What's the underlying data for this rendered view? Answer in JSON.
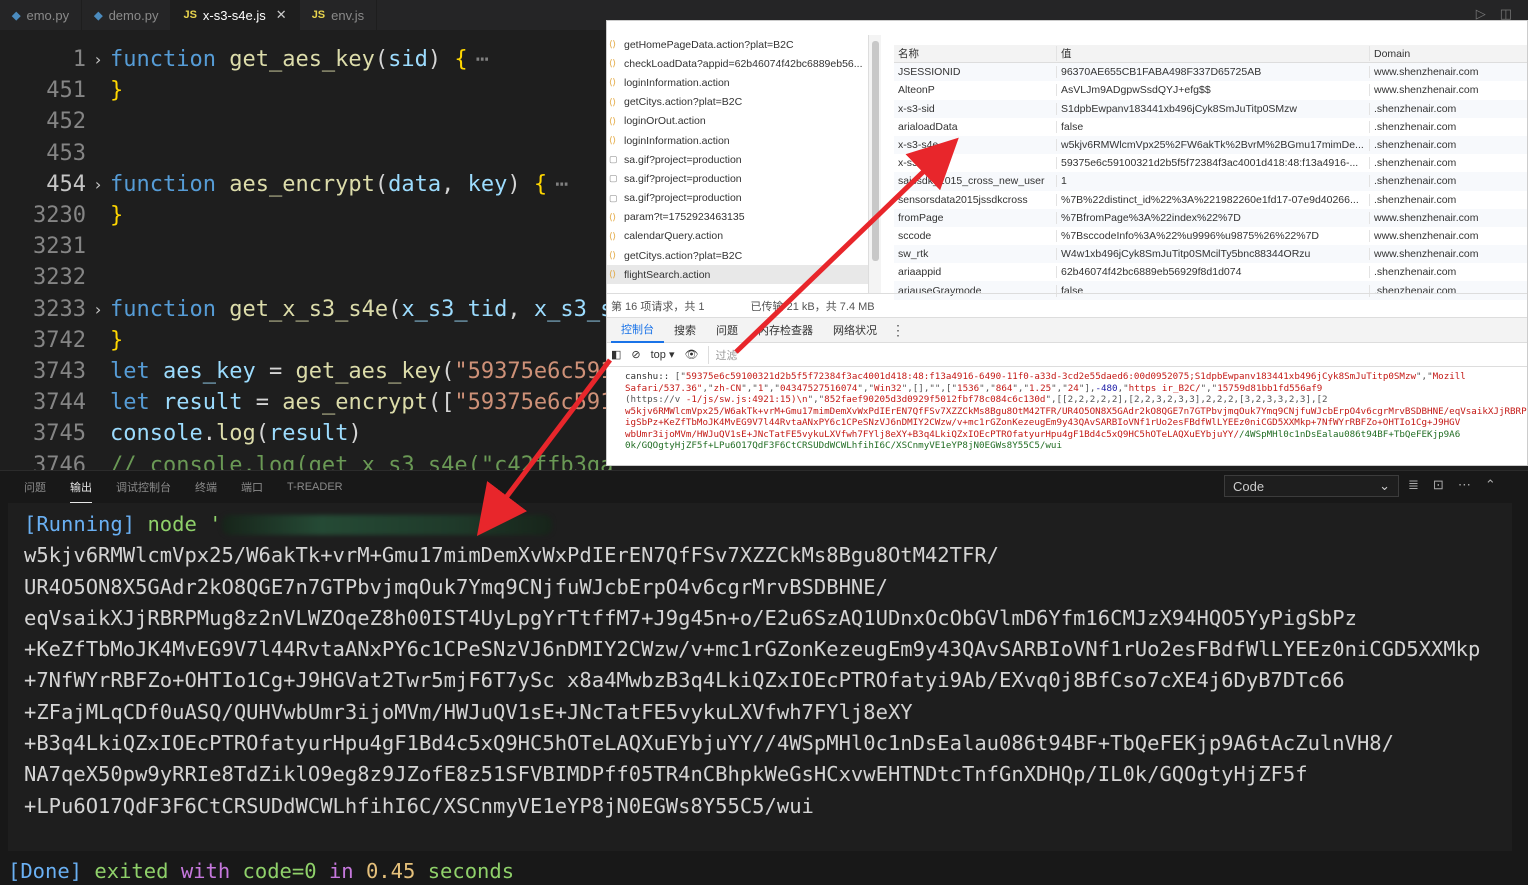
{
  "tabs": [
    {
      "name": "emo.py",
      "type": "py",
      "active": false
    },
    {
      "name": "demo.py",
      "type": "py",
      "active": false
    },
    {
      "name": "x-s3-s4e.js",
      "type": "js",
      "active": true
    },
    {
      "name": "env.js",
      "type": "js",
      "active": false
    }
  ],
  "tab_icons": {
    "py": "python-icon",
    "js": "JS"
  },
  "editor": {
    "lines": [
      {
        "num": "1",
        "fold": true,
        "parts": [
          [
            "kw",
            "function "
          ],
          [
            "fn",
            "get_aes_key"
          ],
          [
            "op",
            "("
          ],
          [
            "par",
            "sid"
          ],
          [
            "op",
            ") "
          ],
          [
            "br",
            "{"
          ]
        ],
        "dots": true
      },
      {
        "num": "451",
        "parts": [
          [
            "br",
            "}"
          ]
        ]
      },
      {
        "num": "452",
        "parts": []
      },
      {
        "num": "453",
        "parts": []
      },
      {
        "num": "454",
        "fold": true,
        "cur": true,
        "parts": [
          [
            "kw",
            "function "
          ],
          [
            "fn",
            "aes_encrypt"
          ],
          [
            "op",
            "("
          ],
          [
            "par",
            "data"
          ],
          [
            "op",
            ", "
          ],
          [
            "par",
            "key"
          ],
          [
            "op",
            ") "
          ],
          [
            "br",
            "{"
          ]
        ],
        "dots": true
      },
      {
        "num": "3230",
        "parts": [
          [
            "br",
            "}"
          ]
        ]
      },
      {
        "num": "3231",
        "parts": []
      },
      {
        "num": "3232",
        "parts": []
      },
      {
        "num": "3233",
        "fold": true,
        "parts": [
          [
            "kw",
            "function "
          ],
          [
            "fn",
            "get_x_s3_s4e"
          ],
          [
            "op",
            "("
          ],
          [
            "par",
            "x_s3_tid"
          ],
          [
            "op",
            ", "
          ],
          [
            "par",
            "x_s3_si"
          ]
        ]
      },
      {
        "num": "3742",
        "parts": [
          [
            "br",
            "}"
          ]
        ]
      },
      {
        "num": "3743",
        "parts": [
          [
            "kw",
            "let "
          ],
          [
            "par",
            "aes_key"
          ],
          [
            "op",
            " = "
          ],
          [
            "fn",
            "get_aes_key"
          ],
          [
            "op",
            "("
          ],
          [
            "str",
            "\"59375e6c5910"
          ]
        ]
      },
      {
        "num": "3744",
        "parts": [
          [
            "kw",
            "let "
          ],
          [
            "par",
            "result"
          ],
          [
            "op",
            " = "
          ],
          [
            "fn",
            "aes_encrypt"
          ],
          [
            "op",
            "(["
          ],
          [
            "str",
            "\"59375e6c5910"
          ]
        ]
      },
      {
        "num": "3745",
        "parts": [
          [
            "par",
            "console"
          ],
          [
            "op",
            "."
          ],
          [
            "fn",
            "log"
          ],
          [
            "op",
            "("
          ],
          [
            "par",
            "result"
          ],
          [
            "op",
            ")"
          ]
        ]
      },
      {
        "num": "3746",
        "parts": [
          [
            "cmt",
            "// console.log(get_x_s3_s4e(\"c42f"
          ],
          [
            "cmt",
            "fb3ga"
          ]
        ]
      }
    ]
  },
  "devtools": {
    "requests": [
      "getHomePageData.action?plat=B2C",
      "checkLoadData?appid=62b46074f42bc6889eb56...",
      "loginInformation.action",
      "getCitys.action?plat=B2C",
      "loginOrOut.action",
      "loginInformation.action",
      "sa.gif?project=production",
      "sa.gif?project=production",
      "sa.gif?project=production",
      "param?t=1752923463135",
      "calendarQuery.action",
      "getCitys.action?plat=B2C",
      "flightSearch.action"
    ],
    "request_icons": [
      "xhr",
      "xhr",
      "xhr",
      "xhr",
      "xhr",
      "xhr",
      "img",
      "img",
      "img",
      "xhr",
      "xhr",
      "xhr",
      "xhr"
    ],
    "cookie_headers": [
      "名称",
      "值",
      "Domain"
    ],
    "cookies": [
      [
        "JSESSIONID",
        "96370AE655CB1FABA498F337D65725AB",
        "www.shenzhenair.com"
      ],
      [
        "AlteonP",
        "AsVLJm9ADgpwSsdQYJ+efg$$",
        "www.shenzhenair.com"
      ],
      [
        "x-s3-sid",
        "S1dpbEwpanv183441xb496jCyk8SmJuTitp0SMzw",
        ".shenzhenair.com"
      ],
      [
        "arialoadData",
        "false",
        ".shenzhenair.com"
      ],
      [
        "x-s3-s4e",
        "w5kjv6RMWlcmVpx25%2FW6akTk%2BvrM%2BGmu17mimDe...",
        ".shenzhenair.com"
      ],
      [
        "x-s3-tid",
        "59375e6c59100321d2b5f5f72384f3ac4001d418:48:f13a4916-...",
        ".shenzhenair.com"
      ],
      [
        "sajssdk_2015_cross_new_user",
        "1",
        ".shenzhenair.com"
      ],
      [
        "sensorsdata2015jssdkcross",
        "%7B%22distinct_id%22%3A%221982260e1fd17-07e9d40266...",
        ".shenzhenair.com"
      ],
      [
        "fromPage",
        "%7BfromPage%3A%22index%22%7D",
        "www.shenzhenair.com"
      ],
      [
        "sccode",
        "%7BsccodeInfo%3A%22%u9996%u9875%26%22%7D",
        "www.shenzhenair.com"
      ],
      [
        "sw_rtk",
        "W4w1xb496jCyk8SmJuTitp0SMcilTy5bnc88344ORzu",
        "www.shenzhenair.com"
      ],
      [
        "ariaappid",
        "62b46074f42bc6889eb56929f8d1d074",
        ".shenzhenair.com"
      ],
      [
        "ariauseGraymode",
        "false",
        ".shenzhenair.com"
      ]
    ],
    "status_left": "第 16 项请求，共 1",
    "status_right": "已传输 21 kB，共 7.4 MB",
    "tabs": [
      "控制台",
      "搜索",
      "问题",
      "内存检查器",
      "网络状况"
    ],
    "console_top": "top",
    "console_filter": "过滤",
    "console_lines": [
      [
        [
          "c-label",
          "canshu:: "
        ],
        [
          "c-gray",
          "[\""
        ],
        [
          "c-str",
          "59375e6c59100321d2b5f5f72384f3ac4001d418:48:f13a4916-6490-11f0-a33d-3cd2e55daed6:00d0952075;S1dpbEwpanv183441xb496jCyk8SmJuTitp0SMzw"
        ],
        [
          "c-gray",
          "\",\""
        ],
        [
          "c-str",
          "Mozill"
        ]
      ],
      [
        [
          "c-str",
          "Safari/537.36\""
        ],
        [
          "c-gray",
          ",\""
        ],
        [
          "c-str",
          "zh-CN"
        ],
        [
          "c-gray",
          "\",\""
        ],
        [
          "c-str",
          "1"
        ],
        [
          "c-gray",
          "\",\""
        ],
        [
          "c-str",
          "04347527516074"
        ],
        [
          "c-gray",
          "\",\""
        ],
        [
          "c-str",
          "Win32"
        ],
        [
          "c-gray",
          "\",[],\"\",[\""
        ],
        [
          "c-str",
          "1536"
        ],
        [
          "c-gray",
          "\",\""
        ],
        [
          "c-str",
          "864"
        ],
        [
          "c-gray",
          "\",\""
        ],
        [
          "c-str",
          "1.25"
        ],
        [
          "c-gray",
          "\",\""
        ],
        [
          "c-str",
          "24"
        ],
        [
          "c-gray",
          "\"],"
        ],
        [
          "c-blue",
          "-480"
        ],
        [
          "c-gray",
          ",\""
        ],
        [
          "c-str",
          "https"
        ],
        [
          "c-gray",
          "                 "
        ],
        [
          "c-str",
          "ir_B2C/"
        ],
        [
          "c-gray",
          "\",\""
        ],
        [
          "c-str",
          "15759d81bb1fd556af9"
        ]
      ],
      [
        [
          "c-gray",
          "(https://v                       "
        ],
        [
          "c-str",
          "-1/js/sw.js:4921:15)\\n"
        ],
        [
          "c-gray",
          "\",\""
        ],
        [
          "c-str",
          "852faef90205d3d0929f5012fbf78c084c6c130d"
        ],
        [
          "c-gray",
          "\",[[2,2,2,2,2],[2,2,3,2,3,3],2,2,2,[3,2,3,3,2,3],[2"
        ]
      ],
      [
        [
          "c-str",
          "w5kjv6RMWlcmVpx25/W6akTk+vrM+Gmu17mimDemXvWxPdIErEN7QfFSv7XZZCkMs8Bgu8OtM42TFR/UR4O5ON8X5GAdr2kO8QGE7n7GTPbvjmqOuk7Ymq9CNjfuWJcbErpO4v6cgrMrvBSDBHNE/eqVsaikXJjRBRPMug8z2nVLWZOqeZ8h00"
        ]
      ],
      [
        [
          "c-str",
          "igSbPz+KeZfTbMoJK4MvEG9V7l44RvtaANxPY6c1CPeSNzVJ6nDMIY2CWzw/v+mc1rGZonKezeugEm9y43QAvSARBIoVNf1rUo2esFBdfWlLYEEz0niCGD5XXMkp+7NfWYrRBFZo+OHTIo1Cg+J9HGV"
        ]
      ],
      [
        [
          "c-str",
          "wbUmr3ijoMVm/HWJuQV1sE+JNcTatFE5vykuLXVfwh7FYlj8eXY+B3q4LkiQZxIOEcPTROfatyurHpu4gF1Bd4c5xQ9HC5hOTeLAQXuEYbjuYY/"
        ],
        [
          "c-green",
          "/4WSpMHl0c1nDsEalau086t94BF+TbQeFEKjp9A6"
        ]
      ],
      [
        [
          "c-green",
          "0k/GQOgtyHjZF5f+LPu6O17QdF3F6CtCRSUDdWCWLhfihI6C/XSCnmyVE1eYP8jN0EGWs8Y55C5/wui"
        ]
      ]
    ]
  },
  "panel": {
    "tabs": [
      "问题",
      "输出",
      "调试控制台",
      "终端",
      "端口",
      "T-READER"
    ],
    "active_tab": "输出",
    "output_channel": "Code",
    "running_label": "[Running]",
    "running_cmd": "node '",
    "output_lines": [
      "w5kjv6RMWlcmVpx25/W6akTk+vrM+Gmu17mimDemXvWxPdIErEN7QfFSv7XZZCkMs8Bgu8OtM42TFR/",
      "UR4O5ON8X5GAdr2kO8QGE7n7GTPbvjmqOuk7Ymq9CNjfuWJcbErpO4v6cgrMrvBSDBHNE/",
      "eqVsaikXJjRBRPMug8z2nVLWZOqeZ8h00IST4UyLpgYrTtffM7+J9g45n+o/E2u6SzAQ1UDnxOcObGVlmD6Yfm16CMJzX94HQO5YyPigSbPz",
      "+KeZfTbMoJK4MvEG9V7l44RvtaANxPY6c1CPeSNzVJ6nDMIY2CWzw/v+mc1rGZonKezeugEm9y43QAvSARBIoVNf1rUo2esFBdfWlLYEEz0niCGD5XXMkp",
      "+7NfWYrRBFZo+OHTIo1Cg+J9HGVat2Twr5mjF6T7ySc x8a4MwbzB3q4LkiQZxIOEcPTROfatyi9Ab/EXvq0j8BfCso7cXE4j6DyB7DTc66",
      "+ZFajMLqCDf0uASQ/QUHVwbUmr3ijoMVm/HWJuQV1sE+JNcTatFE5vykuLXVfwh7FYlj8eXY",
      "+B3q4LkiQZxIOEcPTROfatyurHpu4gF1Bd4c5xQ9HC5hOTeLAQXuEYbjuYY//4WSpMHl0c1nDsEalau086t94BF+TbQeFEKjp9A6tAcZulnVH8/",
      "NA7qeX50pw9yRRIe8TdZiklO9eg8z9JZofE8z51SFVBIMDPff05TR4nCBhpkWeGsHCxvwEHTNDtcTnfGnXDHQp/IL0k/GQOgtyHjZF5f",
      "+LPu6O17QdF3F6CtCRSUDdWCWLhfihI6C/XSCnmyVE1eYP8jN0EGWs8Y55C5/wui"
    ],
    "done": {
      "label": "[Done]",
      "exited": "exited",
      "with": "with",
      "code": "code=0",
      "in": "in",
      "time": "0.45",
      "seconds": "seconds"
    }
  },
  "colors": {
    "arrow": "#e8262b",
    "accent": "#1a73e8"
  }
}
